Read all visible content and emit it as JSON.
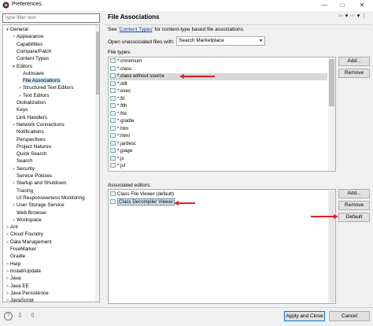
{
  "window": {
    "title": "Preferences",
    "buttons": [
      "—",
      "□",
      "✕"
    ]
  },
  "left": {
    "filter_placeholder": "type filter text",
    "tree": [
      {
        "label": "General",
        "depth": 0,
        "twisty": "▼"
      },
      {
        "label": "Appearance",
        "depth": 1,
        "twisty": ">"
      },
      {
        "label": "Capabilities",
        "depth": 1,
        "twisty": ""
      },
      {
        "label": "Compare/Patch",
        "depth": 1,
        "twisty": ""
      },
      {
        "label": "Content Types",
        "depth": 1,
        "twisty": ""
      },
      {
        "label": "Editors",
        "depth": 1,
        "twisty": "▼"
      },
      {
        "label": "Autosave",
        "depth": 2,
        "twisty": ""
      },
      {
        "label": "File Associations",
        "depth": 2,
        "twisty": "",
        "selected": true
      },
      {
        "label": "Structured Text Editors",
        "depth": 2,
        "twisty": ">"
      },
      {
        "label": "Text Editors",
        "depth": 2,
        "twisty": ">"
      },
      {
        "label": "Globalization",
        "depth": 1,
        "twisty": ""
      },
      {
        "label": "Keys",
        "depth": 1,
        "twisty": ""
      },
      {
        "label": "Link Handlers",
        "depth": 1,
        "twisty": ""
      },
      {
        "label": "Network Connections",
        "depth": 1,
        "twisty": ">"
      },
      {
        "label": "Notifications",
        "depth": 1,
        "twisty": ""
      },
      {
        "label": "Perspectives",
        "depth": 1,
        "twisty": ""
      },
      {
        "label": "Project Natures",
        "depth": 1,
        "twisty": ""
      },
      {
        "label": "Quick Search",
        "depth": 1,
        "twisty": ""
      },
      {
        "label": "Search",
        "depth": 1,
        "twisty": ""
      },
      {
        "label": "Security",
        "depth": 1,
        "twisty": ">"
      },
      {
        "label": "Service Policies",
        "depth": 1,
        "twisty": ""
      },
      {
        "label": "Startup and Shutdown",
        "depth": 1,
        "twisty": ">"
      },
      {
        "label": "Tracing",
        "depth": 1,
        "twisty": ""
      },
      {
        "label": "UI Responsiveness Monitoring",
        "depth": 1,
        "twisty": ""
      },
      {
        "label": "User Storage Service",
        "depth": 1,
        "twisty": ">"
      },
      {
        "label": "Web Browser",
        "depth": 1,
        "twisty": ""
      },
      {
        "label": "Workspace",
        "depth": 1,
        "twisty": ">"
      },
      {
        "label": "Ant",
        "depth": 0,
        "twisty": ">"
      },
      {
        "label": "Cloud Foundry",
        "depth": 0,
        "twisty": ">"
      },
      {
        "label": "Data Management",
        "depth": 0,
        "twisty": ">"
      },
      {
        "label": "FreeMarker",
        "depth": 0,
        "twisty": ""
      },
      {
        "label": "Gradle",
        "depth": 0,
        "twisty": ""
      },
      {
        "label": "Help",
        "depth": 0,
        "twisty": ">"
      },
      {
        "label": "Install/Update",
        "depth": 0,
        "twisty": ">"
      },
      {
        "label": "Java",
        "depth": 0,
        "twisty": ">"
      },
      {
        "label": "Java EE",
        "depth": 0,
        "twisty": ">"
      },
      {
        "label": "Java Persistence",
        "depth": 0,
        "twisty": ">"
      },
      {
        "label": "JavaScript",
        "depth": 0,
        "twisty": ">"
      }
    ]
  },
  "main": {
    "title": "File Associations",
    "toolbar": [
      "⇦",
      "▾",
      "⇨",
      "▾",
      "⋮"
    ],
    "desc_before": "See '",
    "desc_link": "Content Types",
    "desc_after": "' for content-type based file associations.",
    "open_label": "Open unassociated files with:",
    "open_value": "Search Marketplace",
    "file_types_label": "File types:",
    "file_types": [
      "*.chromium",
      "*.class",
      "*.class without source",
      "*.ddl",
      "*.exec",
      "*.ftl",
      "*.ftlh",
      "*.ftlx",
      "*.gradle",
      "*.htm",
      "*.html",
      "*.jardesc",
      "*.jpage",
      "*.js",
      "*.jsf"
    ],
    "file_types_selected": 2,
    "add_label": "Add...",
    "remove_label": "Remove",
    "assoc_label": "Associated editors:",
    "editors": [
      "Class File Viewer (default)",
      "Class Decompiler Viewer"
    ],
    "editors_selected": 1,
    "assoc_add_label": "Add...",
    "assoc_remove_label": "Remove",
    "default_label": "Default"
  },
  "bottom": {
    "help_icon": "?",
    "import_icon": "⇩",
    "export_icon": "⇧",
    "apply_close_label": "Apply and Close",
    "cancel_label": "Cancel"
  },
  "annotation_color": "#e02020"
}
